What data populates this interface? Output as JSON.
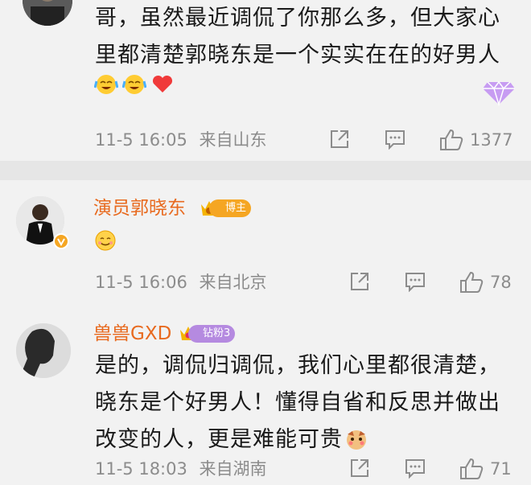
{
  "comments": [
    {
      "text_line1": "哥，虽然最近调侃了你那么多，但大家心",
      "text_line2": "里都清楚郭晓东是一个实实在在的好男人",
      "emojis": [
        "laugh-cry-emoji",
        "laugh-cry-emoji",
        "red-heart-emoji"
      ],
      "time": "11-5 16:05",
      "location": "来自山东",
      "likes": "1377"
    },
    {
      "username": "演员郭晓东",
      "badge": "博主",
      "emoji": "smile-emoji",
      "time": "11-5 16:06",
      "location": "来自北京",
      "likes": "78"
    },
    {
      "username": "兽兽GXD",
      "badge": "钻粉3",
      "text_line1": "是的，调侃归调侃，我们心里都很清楚，",
      "text_line2": "晓东是个好男人！懂得自省和反思并做出",
      "text_line3": "改变的人，更是难能可贵",
      "time": "11-5 18:03",
      "location": "来自湖南",
      "likes": "71"
    }
  ],
  "colors": {
    "username": "#e86a1f",
    "meta": "#8c8c8c",
    "background": "#f2f2f2",
    "divider": "#e6e6e6"
  }
}
